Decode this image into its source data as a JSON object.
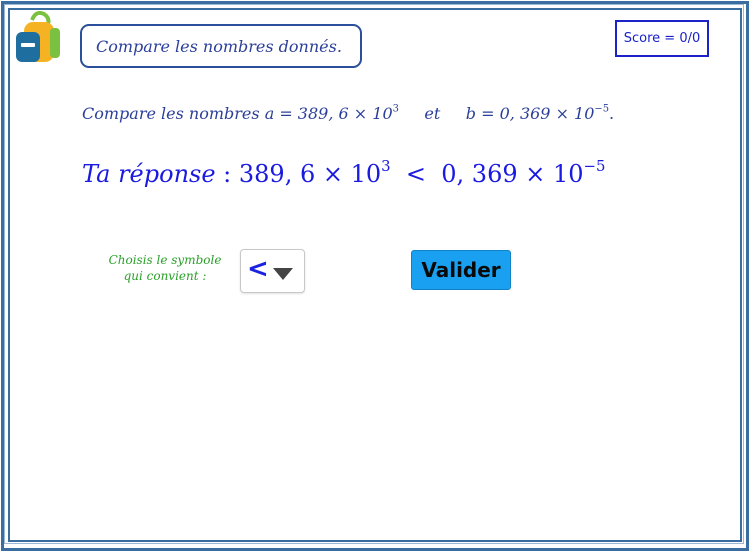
{
  "header": {
    "title": "Compare les nombres donnés.",
    "score": "Score = 0/0"
  },
  "question": {
    "intro": "Compare les nombres",
    "a_label": "a = 389, 6 × 10",
    "a_exp": "3",
    "connector": "et",
    "b_label": "b = 0, 369 × 10",
    "b_exp": "−5",
    "end": "."
  },
  "answer": {
    "label": "Ta réponse",
    "colon": " : ",
    "left": "389, 6 × 10",
    "left_exp": "3",
    "symbol": "<",
    "right": "0, 369 × 10",
    "right_exp": "−5"
  },
  "controls": {
    "choose_line1": "Choisis le symbole",
    "choose_line2": "qui convient :",
    "selected_symbol": "<",
    "submit_label": "Valider"
  },
  "colors": {
    "frame": "#3a6ea0",
    "title_text": "#2b3f9a",
    "answer_text": "#1a1ae0",
    "hint_text": "#2aa02a",
    "button": "#1aa0f0"
  },
  "icons": {
    "logo": "backpack-icon",
    "dropdown": "caret-down-icon"
  }
}
